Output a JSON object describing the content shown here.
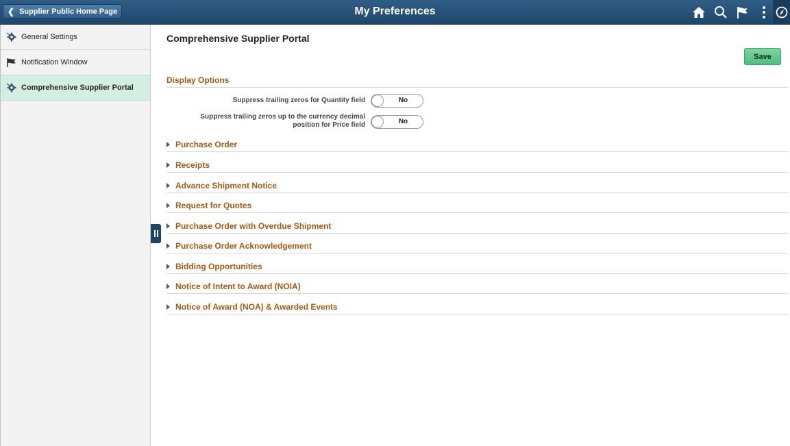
{
  "banner": {
    "back_label": "Supplier Public Home Page",
    "title": "My Preferences",
    "icons": [
      "home-icon",
      "search-icon",
      "flag-icon",
      "actions-menu-icon",
      "navbar-icon"
    ]
  },
  "sidebar": {
    "items": [
      {
        "label": "General Settings",
        "icon": "settings-icon",
        "selected": false
      },
      {
        "label": "Notification Window",
        "icon": "flag-icon",
        "selected": false
      },
      {
        "label": "Comprehensive Supplier Portal",
        "icon": "settings-icon",
        "selected": true
      }
    ]
  },
  "main": {
    "title": "Comprehensive Supplier Portal",
    "save_label": "Save",
    "display_options": {
      "heading": "Display Options",
      "options": [
        {
          "label": "Suppress trailing zeros for Quantity field",
          "value": "No"
        },
        {
          "label_line1": "Suppress trailing zeros up to the currency decimal",
          "label_line2": "position for Price field",
          "value": "No"
        }
      ]
    },
    "groups": [
      "Purchase Order",
      "Receipts",
      "Advance Shipment Notice",
      "Request for Quotes",
      "Purchase Order with Overdue Shipment",
      "Purchase Order Acknowledgement",
      "Bidding Opportunities",
      "Notice of Intent to Award (NOIA)",
      "Notice of Award (NOA) & Awarded Events"
    ]
  },
  "colors": {
    "banner": "#2a5479",
    "section_text": "#a35a14",
    "selected_nav": "#d3efe1",
    "save_button": "#5ec68a"
  }
}
